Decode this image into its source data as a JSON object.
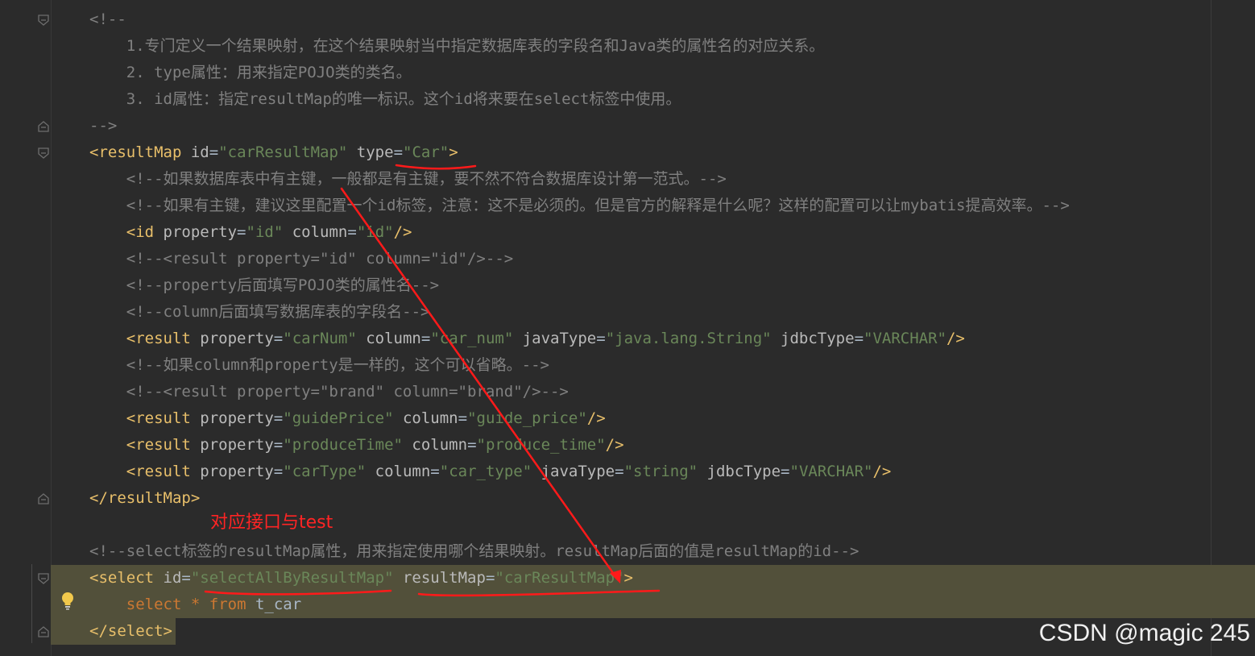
{
  "editor": {
    "lines": [
      {
        "id": "cm-open",
        "tokens": [
          {
            "cls": "c",
            "text": "<!--"
          }
        ]
      },
      {
        "id": "cm-1",
        "tokens": [
          {
            "cls": "c",
            "text": "    1.专门定义一个结果映射，在这个结果映射当中指定数据库表的字段名和Java类的属性名的对应关系。"
          }
        ]
      },
      {
        "id": "cm-2",
        "tokens": [
          {
            "cls": "c",
            "text": "    2. type属性：用来指定POJO类的类名。"
          }
        ]
      },
      {
        "id": "cm-3",
        "tokens": [
          {
            "cls": "c",
            "text": "    3. id属性：指定resultMap的唯一标识。这个id将来要在select标签中使用。"
          }
        ]
      },
      {
        "id": "cm-close",
        "tokens": [
          {
            "cls": "c",
            "text": "-->"
          }
        ]
      },
      {
        "id": "resultmap-open",
        "tokens": [
          {
            "cls": "t",
            "text": "<resultMap "
          },
          {
            "cls": "a",
            "text": "id"
          },
          {
            "cls": "p",
            "text": "="
          },
          {
            "cls": "v",
            "text": "\"carResultMap\""
          },
          {
            "cls": "p",
            "text": " "
          },
          {
            "cls": "a",
            "text": "type"
          },
          {
            "cls": "p",
            "text": "="
          },
          {
            "cls": "v",
            "text": "\"Car\""
          },
          {
            "cls": "t",
            "text": ">"
          }
        ]
      },
      {
        "id": "cm-pk",
        "tokens": [
          {
            "cls": "c",
            "text": "    <!--如果数据库表中有主键，一般都是有主键，要不然不符合数据库设计第一范式。-->"
          }
        ]
      },
      {
        "id": "cm-id",
        "tokens": [
          {
            "cls": "c",
            "text": "    <!--如果有主键，建议这里配置一个id标签，注意：这不是必须的。但是官方的解释是什么呢？这样的配置可以让mybatis提高效率。-->"
          }
        ]
      },
      {
        "id": "id-tag",
        "tokens": [
          {
            "cls": "p",
            "text": "    "
          },
          {
            "cls": "t",
            "text": "<id "
          },
          {
            "cls": "a",
            "text": "property"
          },
          {
            "cls": "p",
            "text": "="
          },
          {
            "cls": "v",
            "text": "\"id\""
          },
          {
            "cls": "p",
            "text": " "
          },
          {
            "cls": "a",
            "text": "column"
          },
          {
            "cls": "p",
            "text": "="
          },
          {
            "cls": "v",
            "text": "\"id\""
          },
          {
            "cls": "t",
            "text": "/>"
          }
        ]
      },
      {
        "id": "cm-result-id",
        "tokens": [
          {
            "cls": "c",
            "text": "    <!--<result property=\"id\" column=\"id\"/>-->"
          }
        ]
      },
      {
        "id": "cm-property",
        "tokens": [
          {
            "cls": "c",
            "text": "    <!--property后面填写POJO类的属性名-->"
          }
        ]
      },
      {
        "id": "cm-column",
        "tokens": [
          {
            "cls": "c",
            "text": "    <!--column后面填写数据库表的字段名-->"
          }
        ]
      },
      {
        "id": "result-carnum",
        "tokens": [
          {
            "cls": "p",
            "text": "    "
          },
          {
            "cls": "t",
            "text": "<result "
          },
          {
            "cls": "a",
            "text": "property"
          },
          {
            "cls": "p",
            "text": "="
          },
          {
            "cls": "v",
            "text": "\"carNum\""
          },
          {
            "cls": "p",
            "text": " "
          },
          {
            "cls": "a",
            "text": "column"
          },
          {
            "cls": "p",
            "text": "="
          },
          {
            "cls": "v",
            "text": "\"car_num\""
          },
          {
            "cls": "p",
            "text": " "
          },
          {
            "cls": "a",
            "text": "javaType"
          },
          {
            "cls": "p",
            "text": "="
          },
          {
            "cls": "v",
            "text": "\"java.lang.String\""
          },
          {
            "cls": "p",
            "text": " "
          },
          {
            "cls": "a",
            "text": "jdbcType"
          },
          {
            "cls": "p",
            "text": "="
          },
          {
            "cls": "v",
            "text": "\"VARCHAR\""
          },
          {
            "cls": "t",
            "text": "/>"
          }
        ]
      },
      {
        "id": "cm-same",
        "tokens": [
          {
            "cls": "c",
            "text": "    <!--如果column和property是一样的，这个可以省略。-->"
          }
        ]
      },
      {
        "id": "cm-brand",
        "tokens": [
          {
            "cls": "c",
            "text": "    <!--<result property=\"brand\" column=\"brand\"/>-->"
          }
        ]
      },
      {
        "id": "result-guideprice",
        "tokens": [
          {
            "cls": "p",
            "text": "    "
          },
          {
            "cls": "t",
            "text": "<result "
          },
          {
            "cls": "a",
            "text": "property"
          },
          {
            "cls": "p",
            "text": "="
          },
          {
            "cls": "v",
            "text": "\"guidePrice\""
          },
          {
            "cls": "p",
            "text": " "
          },
          {
            "cls": "a",
            "text": "column"
          },
          {
            "cls": "p",
            "text": "="
          },
          {
            "cls": "v",
            "text": "\"guide_price\""
          },
          {
            "cls": "t",
            "text": "/>"
          }
        ]
      },
      {
        "id": "result-producetime",
        "tokens": [
          {
            "cls": "p",
            "text": "    "
          },
          {
            "cls": "t",
            "text": "<result "
          },
          {
            "cls": "a",
            "text": "property"
          },
          {
            "cls": "p",
            "text": "="
          },
          {
            "cls": "v",
            "text": "\"produceTime\""
          },
          {
            "cls": "p",
            "text": " "
          },
          {
            "cls": "a",
            "text": "column"
          },
          {
            "cls": "p",
            "text": "="
          },
          {
            "cls": "v",
            "text": "\"produce_time\""
          },
          {
            "cls": "t",
            "text": "/>"
          }
        ]
      },
      {
        "id": "result-cartype",
        "tokens": [
          {
            "cls": "p",
            "text": "    "
          },
          {
            "cls": "t",
            "text": "<result "
          },
          {
            "cls": "a",
            "text": "property"
          },
          {
            "cls": "p",
            "text": "="
          },
          {
            "cls": "v",
            "text": "\"carType\""
          },
          {
            "cls": "p",
            "text": " "
          },
          {
            "cls": "a",
            "text": "column"
          },
          {
            "cls": "p",
            "text": "="
          },
          {
            "cls": "v",
            "text": "\"car_type\""
          },
          {
            "cls": "p",
            "text": " "
          },
          {
            "cls": "a",
            "text": "javaType"
          },
          {
            "cls": "p",
            "text": "="
          },
          {
            "cls": "v",
            "text": "\"string\""
          },
          {
            "cls": "p",
            "text": " "
          },
          {
            "cls": "a",
            "text": "jdbcType"
          },
          {
            "cls": "p",
            "text": "="
          },
          {
            "cls": "v",
            "text": "\"VARCHAR\""
          },
          {
            "cls": "t",
            "text": "/>"
          }
        ]
      },
      {
        "id": "resultmap-close",
        "tokens": [
          {
            "cls": "t",
            "text": "</resultMap>"
          }
        ]
      },
      {
        "id": "blank",
        "tokens": []
      },
      {
        "id": "cm-select",
        "tokens": [
          {
            "cls": "c",
            "text": "<!--select标签的resultMap属性，用来指定使用哪个结果映射。resultMap后面的值是resultMap的id-->"
          }
        ]
      },
      {
        "id": "select-open",
        "tokens": [
          {
            "cls": "t",
            "text": "<select "
          },
          {
            "cls": "a",
            "text": "id"
          },
          {
            "cls": "p",
            "text": "="
          },
          {
            "cls": "v",
            "text": "\"selectAllByResultMap\""
          },
          {
            "cls": "p",
            "text": " "
          },
          {
            "cls": "a",
            "text": "resultMap"
          },
          {
            "cls": "p",
            "text": "="
          },
          {
            "cls": "v",
            "text": "\"carResultMap\""
          },
          {
            "cls": "t",
            "text": ">"
          }
        ]
      },
      {
        "id": "sql-body",
        "tokens": [
          {
            "cls": "p",
            "text": "    "
          },
          {
            "cls": "k",
            "text": "select"
          },
          {
            "cls": "p",
            "text": " "
          },
          {
            "cls": "k",
            "text": "*"
          },
          {
            "cls": "p",
            "text": " "
          },
          {
            "cls": "k",
            "text": "from"
          },
          {
            "cls": "p",
            "text": " t_car"
          }
        ]
      },
      {
        "id": "select-close",
        "tokens": [
          {
            "cls": "t",
            "text": "</select>"
          }
        ]
      }
    ]
  },
  "annotation": {
    "text": "对应接口与test",
    "color": "#ff2424"
  },
  "watermark": "CSDN @magic 245",
  "gutter_icons": [
    "fold-icon",
    "lightbulb-icon"
  ],
  "colors": {
    "background": "#2b2b2b",
    "comment": "#808080",
    "tag": "#e8bf6a",
    "attribute": "#bababa",
    "string": "#6a8759",
    "keyword": "#cc7832",
    "highlight": "#52503a"
  }
}
